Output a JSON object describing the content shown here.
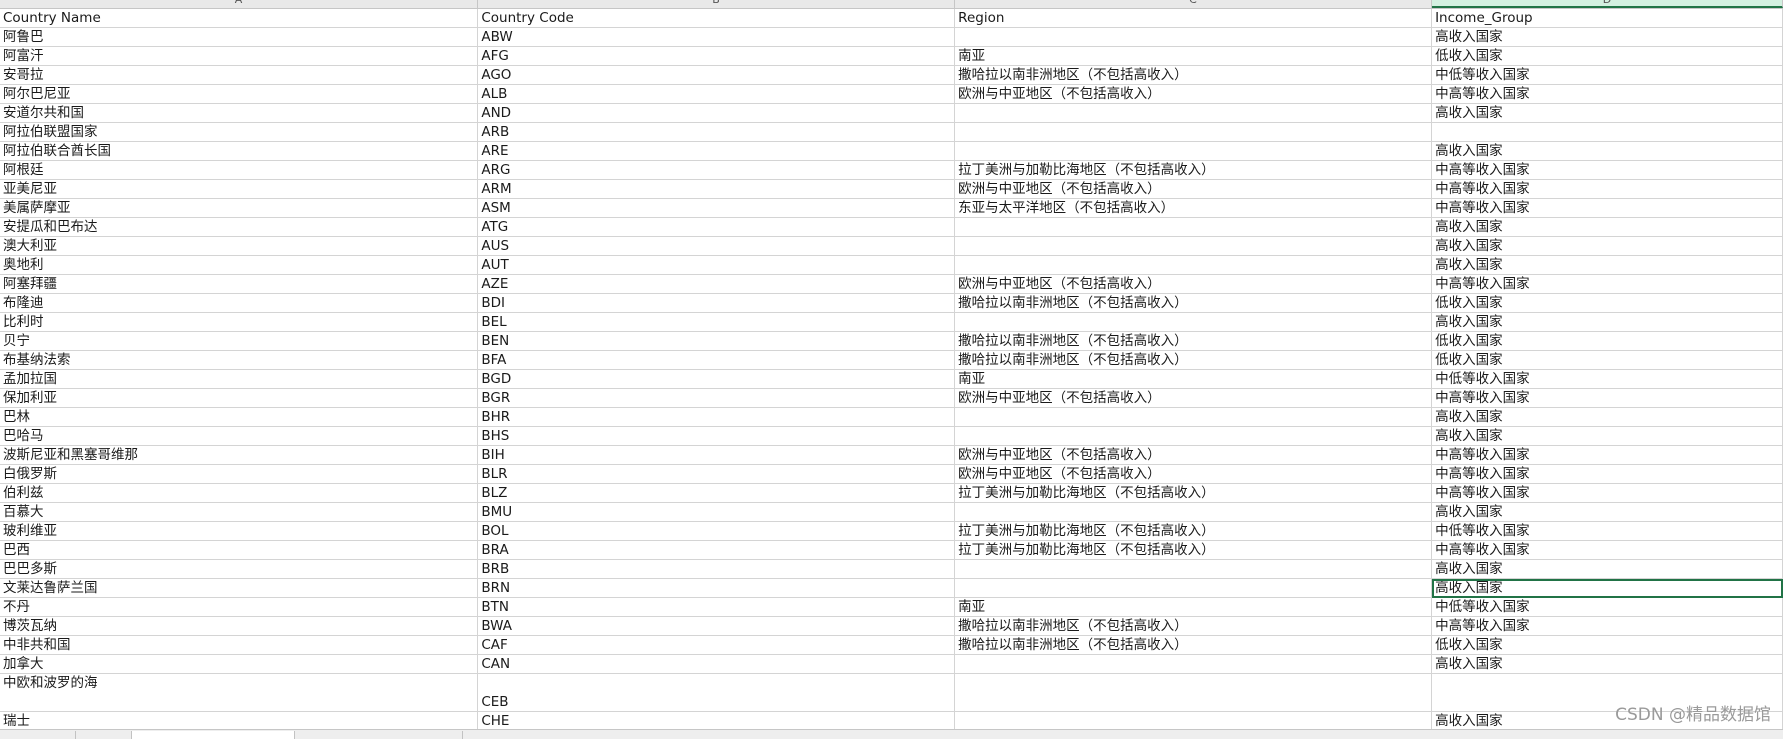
{
  "column_letters": [
    "A",
    "B",
    "C",
    "D"
  ],
  "headers": [
    "Country Name",
    "Country Code",
    "Region",
    "Income_Group"
  ],
  "rows": [
    [
      "阿鲁巴",
      "ABW",
      "",
      "高收入国家"
    ],
    [
      "阿富汗",
      "AFG",
      "南亚",
      "低收入国家"
    ],
    [
      "安哥拉",
      "AGO",
      "撒哈拉以南非洲地区（不包括高收入）",
      "中低等收入国家"
    ],
    [
      "阿尔巴尼亚",
      "ALB",
      "欧洲与中亚地区（不包括高收入）",
      "中高等收入国家"
    ],
    [
      "安道尔共和国",
      "AND",
      "",
      "高收入国家"
    ],
    [
      "阿拉伯联盟国家",
      "ARB",
      "",
      ""
    ],
    [
      "阿拉伯联合酋长国",
      "ARE",
      "",
      "高收入国家"
    ],
    [
      "阿根廷",
      "ARG",
      "拉丁美洲与加勒比海地区（不包括高收入）",
      "中高等收入国家"
    ],
    [
      "亚美尼亚",
      "ARM",
      "欧洲与中亚地区（不包括高收入）",
      "中高等收入国家"
    ],
    [
      "美属萨摩亚",
      "ASM",
      "东亚与太平洋地区（不包括高收入）",
      "中高等收入国家"
    ],
    [
      "安提瓜和巴布达",
      "ATG",
      "",
      "高收入国家"
    ],
    [
      "澳大利亚",
      "AUS",
      "",
      "高收入国家"
    ],
    [
      "奥地利",
      "AUT",
      "",
      "高收入国家"
    ],
    [
      "阿塞拜疆",
      "AZE",
      "欧洲与中亚地区（不包括高收入）",
      "中高等收入国家"
    ],
    [
      "布隆迪",
      "BDI",
      "撒哈拉以南非洲地区（不包括高收入）",
      "低收入国家"
    ],
    [
      "比利时",
      "BEL",
      "",
      "高收入国家"
    ],
    [
      "贝宁",
      "BEN",
      "撒哈拉以南非洲地区（不包括高收入）",
      "低收入国家"
    ],
    [
      "布基纳法索",
      "BFA",
      "撒哈拉以南非洲地区（不包括高收入）",
      "低收入国家"
    ],
    [
      "孟加拉国",
      "BGD",
      "南亚",
      "中低等收入国家"
    ],
    [
      "保加利亚",
      "BGR",
      "欧洲与中亚地区（不包括高收入）",
      "中高等收入国家"
    ],
    [
      "巴林",
      "BHR",
      "",
      "高收入国家"
    ],
    [
      "巴哈马",
      "BHS",
      "",
      "高收入国家"
    ],
    [
      "波斯尼亚和黑塞哥维那",
      "BIH",
      "欧洲与中亚地区（不包括高收入）",
      "中高等收入国家"
    ],
    [
      "白俄罗斯",
      "BLR",
      "欧洲与中亚地区（不包括高收入）",
      "中高等收入国家"
    ],
    [
      "伯利兹",
      "BLZ",
      "拉丁美洲与加勒比海地区（不包括高收入）",
      "中高等收入国家"
    ],
    [
      "百慕大",
      "BMU",
      "",
      "高收入国家"
    ],
    [
      "玻利维亚",
      "BOL",
      "拉丁美洲与加勒比海地区（不包括高收入）",
      "中低等收入国家"
    ],
    [
      "巴西",
      "BRA",
      "拉丁美洲与加勒比海地区（不包括高收入）",
      "中高等收入国家"
    ],
    [
      "巴巴多斯",
      "BRB",
      "",
      "高收入国家"
    ],
    [
      "文莱达鲁萨兰国",
      "BRN",
      "",
      "高收入国家"
    ],
    [
      "不丹",
      "BTN",
      "南亚",
      "中低等收入国家"
    ],
    [
      "博茨瓦纳",
      "BWA",
      "撒哈拉以南非洲地区（不包括高收入）",
      "中高等收入国家"
    ],
    [
      "中非共和国",
      "CAF",
      "撒哈拉以南非洲地区（不包括高收入）",
      "低收入国家"
    ],
    [
      "加拿大",
      "CAN",
      "",
      "高收入国家"
    ],
    [
      "中欧和波罗的海",
      "CEB",
      "",
      ""
    ],
    [
      "瑞士",
      "CHE",
      "",
      "高收入国家"
    ]
  ],
  "watermark": "CSDN @精品数据馆"
}
